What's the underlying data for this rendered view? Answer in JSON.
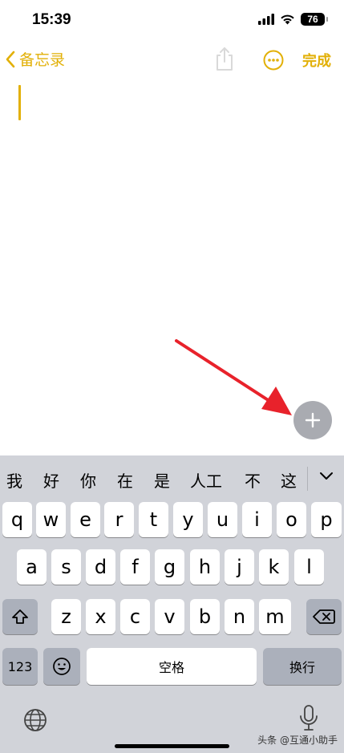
{
  "status": {
    "time": "15:39",
    "battery": "76"
  },
  "nav": {
    "back_label": "备忘录",
    "done_label": "完成"
  },
  "candidates": [
    "我",
    "好",
    "你",
    "在",
    "是",
    "人工",
    "不",
    "这"
  ],
  "keyboard": {
    "row1": [
      "q",
      "w",
      "e",
      "r",
      "t",
      "y",
      "u",
      "i",
      "o",
      "p"
    ],
    "row2": [
      "a",
      "s",
      "d",
      "f",
      "g",
      "h",
      "j",
      "k",
      "l"
    ],
    "row3": [
      "z",
      "x",
      "c",
      "v",
      "b",
      "n",
      "m"
    ],
    "numbers_label": "123",
    "space_label": "空格",
    "return_label": "换行"
  },
  "watermark": "头条 @互通小助手",
  "colors": {
    "accent": "#e2b007",
    "annotation": "#e8222b",
    "keyboard_bg": "#d1d3d9"
  }
}
